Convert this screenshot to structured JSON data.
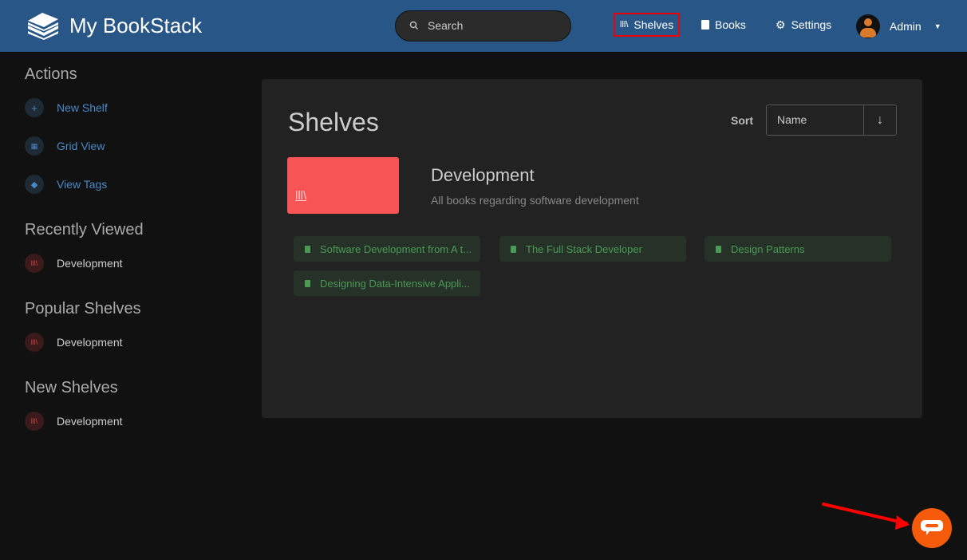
{
  "header": {
    "app_title": "My BookStack",
    "search_placeholder": "Search",
    "nav": [
      {
        "label": "Shelves",
        "icon": "shelves-icon"
      },
      {
        "label": "Books",
        "icon": "book-icon"
      },
      {
        "label": "Settings",
        "icon": "gear-icon"
      }
    ],
    "user": "Admin"
  },
  "sidebar": {
    "actions_title": "Actions",
    "actions": [
      {
        "label": "New Shelf",
        "icon": "plus-icon"
      },
      {
        "label": "Grid View",
        "icon": "grid-icon"
      },
      {
        "label": "View Tags",
        "icon": "tag-icon"
      }
    ],
    "recent_title": "Recently Viewed",
    "recent": [
      "Development"
    ],
    "popular_title": "Popular Shelves",
    "popular": [
      "Development"
    ],
    "new_title": "New Shelves",
    "new": [
      "Development"
    ]
  },
  "main": {
    "title": "Shelves",
    "sort_label": "Sort",
    "sort_value": "Name",
    "sort_dir": "↓",
    "shelf": {
      "name": "Development",
      "description": "All books regarding software development",
      "color": "#f75555",
      "books": [
        "Software Development from A t...",
        "The Full Stack Developer",
        "Design Patterns",
        "Designing Data-Intensive Appli..."
      ]
    }
  }
}
